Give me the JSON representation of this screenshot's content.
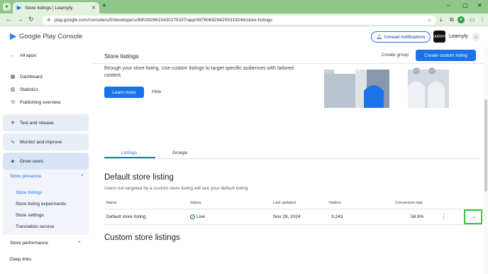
{
  "browser": {
    "tab_title": "Store listings | Learnyfy",
    "url": "play.google.com/console/u/0/developers/8902828615430275337/app/4976069298255319246/store-listings"
  },
  "header": {
    "app_name": "Google Play Console",
    "notifications_label": "Unread notifications",
    "account_name": "Learnyfy",
    "account_logo_text": "LEARNYFY"
  },
  "sidebar": {
    "all_apps": "All apps",
    "items": [
      {
        "label": "Dashboard",
        "icon": "dashboard-icon"
      },
      {
        "label": "Statistics",
        "icon": "bar-chart-icon"
      },
      {
        "label": "Publishing overview",
        "icon": "publish-icon"
      }
    ],
    "groups": {
      "test_release": "Test and release",
      "monitor": "Monitor and improve",
      "grow": "Grow users"
    },
    "store_presence": {
      "title": "Store presence",
      "items": [
        "Store listings",
        "Store listing experiments",
        "Store settings",
        "Translation service"
      ]
    },
    "store_performance": "Store performance",
    "deep_links": "Deep links"
  },
  "main": {
    "title": "Store listings",
    "create_group": "Create group",
    "create_custom": "Create custom listing",
    "promo_text": "through your store listing. Use custom listings to target specific audiences with tailored content.",
    "learn_more": "Learn more",
    "hide": "Hide",
    "tabs": [
      "Listings",
      "Groups"
    ],
    "default_heading": "Default store listing",
    "default_desc": "Users not targeted by a custom store listing will see your default listing",
    "table": {
      "headers": [
        "Name",
        "Status",
        "Last updated",
        "Visitors",
        "Conversion rate"
      ],
      "row": {
        "name": "Default store listing",
        "status": "Live",
        "last_updated": "Nov 28, 2024",
        "visitors": "3,243",
        "conversion_rate": "58.9%"
      }
    },
    "custom_heading": "Custom store listings"
  },
  "colors": {
    "accent": "#1a73e8",
    "browser_frame": "#8fc68a",
    "highlight_box": "#2fcb3a",
    "live_status": "#137333"
  }
}
